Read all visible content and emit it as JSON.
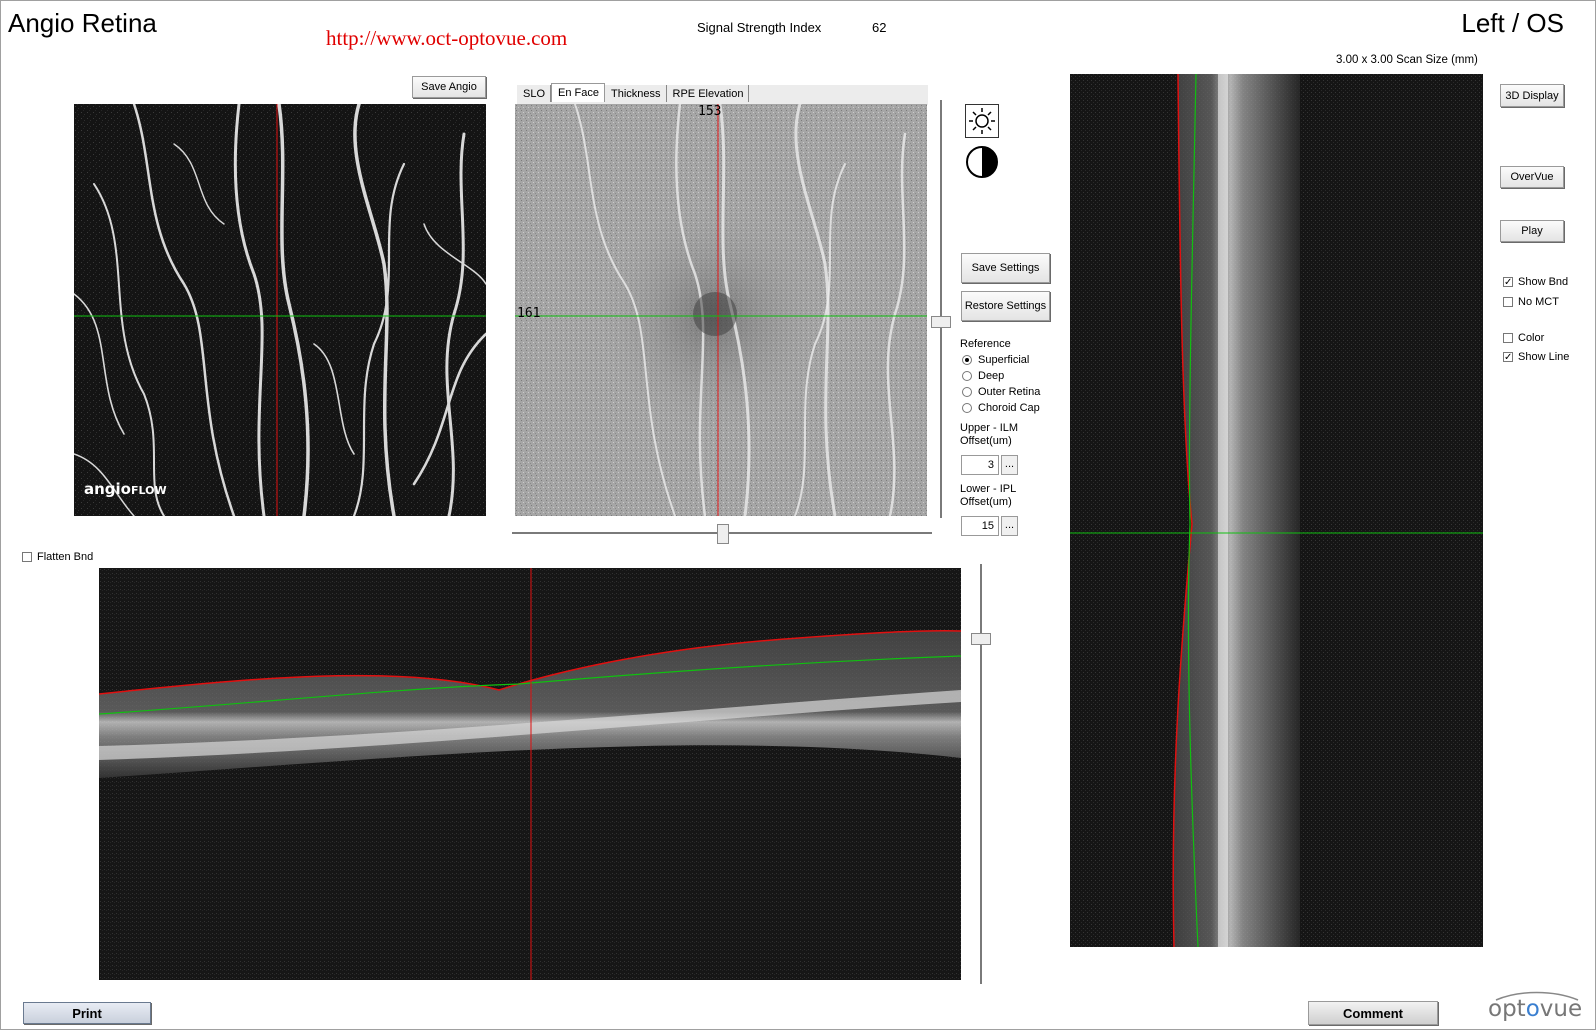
{
  "header": {
    "title": "Angio Retina",
    "url": "http://www.oct-optovue.com",
    "ssi_label": "Signal Strength Index",
    "ssi_value": "62",
    "eye": "Left / OS",
    "scan_size": "3.00 x 3.00 Scan Size (mm)"
  },
  "angio_panel": {
    "save_label": "Save Angio",
    "brand": "angio",
    "brand_suffix": "FLOW"
  },
  "enface_panel": {
    "tabs": [
      {
        "label": "SLO"
      },
      {
        "label": "En Face"
      },
      {
        "label": "Thickness"
      },
      {
        "label": "RPE Elevation"
      }
    ],
    "active_tab": "En Face",
    "x_coord": "153",
    "y_coord": "161"
  },
  "settings": {
    "save_settings": "Save Settings",
    "restore_settings": "Restore Settings",
    "reference_label": "Reference",
    "reference_options": [
      "Superficial",
      "Deep",
      "Outer Retina",
      "Choroid Cap"
    ],
    "reference_selected": "Superficial",
    "upper_label": "Upper - ILM",
    "upper_offset_label": "Offset(um)",
    "upper_value": "3",
    "lower_label": "Lower - IPL",
    "lower_offset_label": "Offset(um)",
    "lower_value": "15",
    "dots": "..."
  },
  "bscan": {
    "flatten_label": "Flatten Bnd",
    "flatten_checked": false
  },
  "right_controls": {
    "display_3d": "3D Display",
    "overvue": "OverVue",
    "play": "Play",
    "show_bnd": "Show Bnd",
    "show_bnd_checked": true,
    "no_mct": "No MCT",
    "no_mct_checked": false,
    "color": "Color",
    "color_checked": false,
    "show_line": "Show Line",
    "show_line_checked": true
  },
  "footer": {
    "print": "Print",
    "comment": "Comment",
    "logo_pre": "opt",
    "logo_mid": "o",
    "logo_post": "vue"
  },
  "icons": {
    "brightness": "sun-icon",
    "contrast": "contrast-icon"
  },
  "colors": {
    "boundary_red": "#e01010",
    "boundary_green": "#10c010",
    "url_red": "#e00000"
  }
}
